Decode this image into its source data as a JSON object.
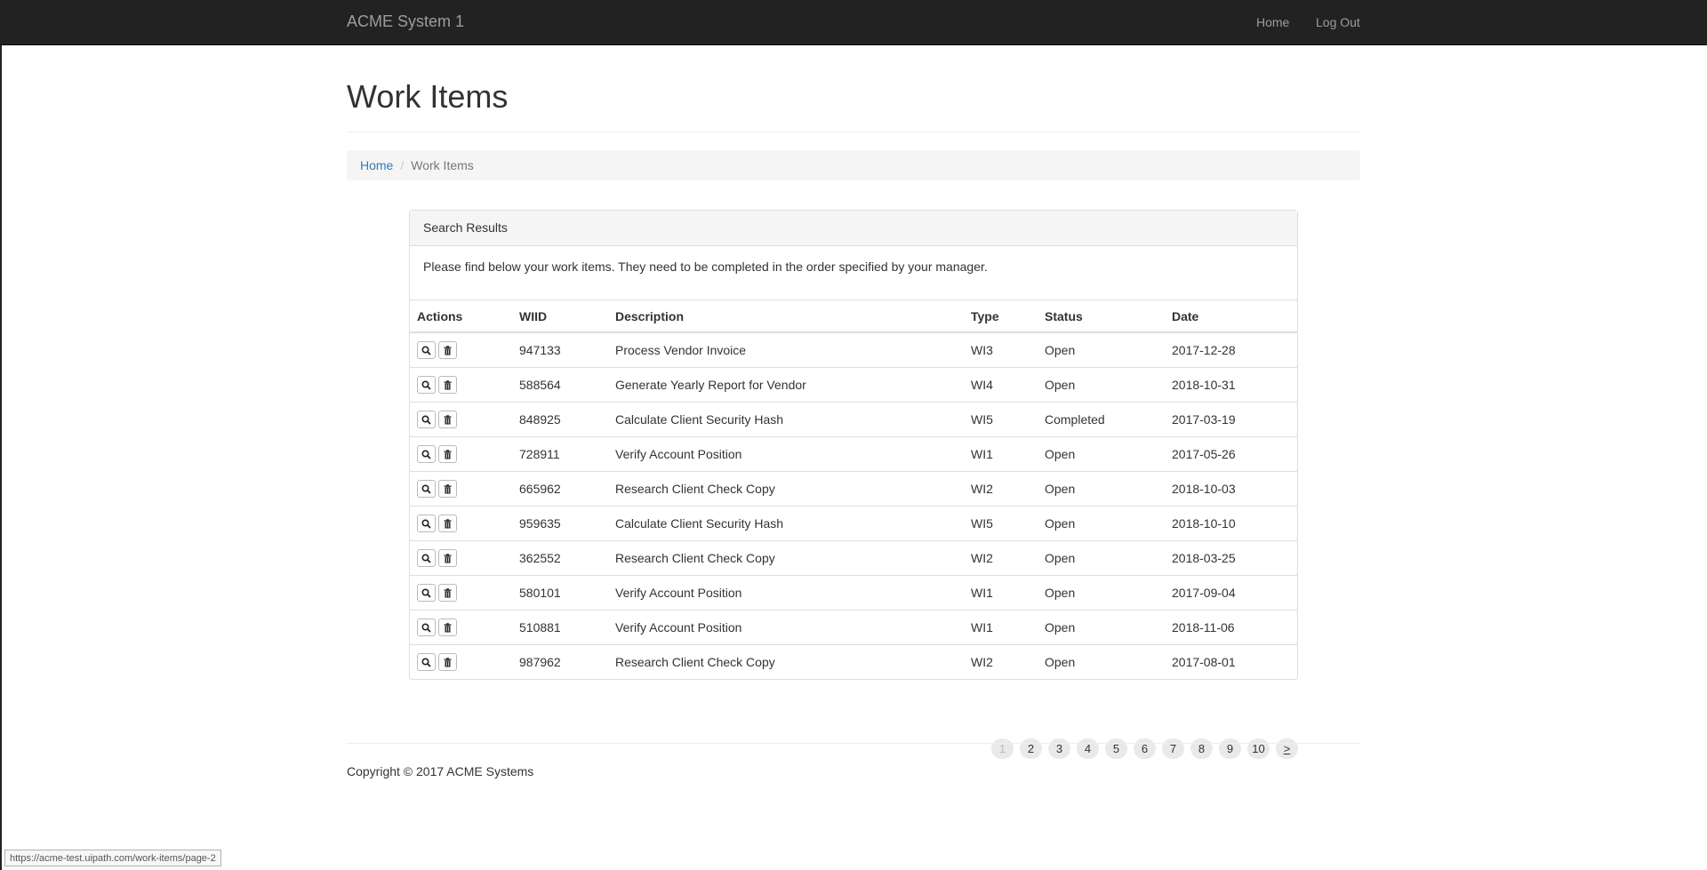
{
  "navbar": {
    "brand": "ACME System 1",
    "links": [
      "Home",
      "Log Out"
    ]
  },
  "page": {
    "title": "Work Items"
  },
  "breadcrumb": {
    "home": "Home",
    "separator": "/",
    "current": "Work Items"
  },
  "panel": {
    "heading": "Search Results",
    "body": "Please find below your work items. They need to be completed in the order specified by your manager."
  },
  "table": {
    "columns": [
      "Actions",
      "WIID",
      "Description",
      "Type",
      "Status",
      "Date"
    ],
    "rows": [
      {
        "wiid": "947133",
        "description": "Process Vendor Invoice",
        "type": "WI3",
        "status": "Open",
        "date": "2017-12-28"
      },
      {
        "wiid": "588564",
        "description": "Generate Yearly Report for Vendor",
        "type": "WI4",
        "status": "Open",
        "date": "2018-10-31"
      },
      {
        "wiid": "848925",
        "description": "Calculate Client Security Hash",
        "type": "WI5",
        "status": "Completed",
        "date": "2017-03-19"
      },
      {
        "wiid": "728911",
        "description": "Verify Account Position",
        "type": "WI1",
        "status": "Open",
        "date": "2017-05-26"
      },
      {
        "wiid": "665962",
        "description": "Research Client Check Copy",
        "type": "WI2",
        "status": "Open",
        "date": "2018-10-03"
      },
      {
        "wiid": "959635",
        "description": "Calculate Client Security Hash",
        "type": "WI5",
        "status": "Open",
        "date": "2018-10-10"
      },
      {
        "wiid": "362552",
        "description": "Research Client Check Copy",
        "type": "WI2",
        "status": "Open",
        "date": "2018-03-25"
      },
      {
        "wiid": "580101",
        "description": "Verify Account Position",
        "type": "WI1",
        "status": "Open",
        "date": "2017-09-04"
      },
      {
        "wiid": "510881",
        "description": "Verify Account Position",
        "type": "WI1",
        "status": "Open",
        "date": "2018-11-06"
      },
      {
        "wiid": "987962",
        "description": "Research Client Check Copy",
        "type": "WI2",
        "status": "Open",
        "date": "2017-08-01"
      }
    ],
    "action_icons": [
      "search-icon",
      "trash-icon"
    ]
  },
  "pagination": {
    "pages": [
      "1",
      "2",
      "3",
      "4",
      "5",
      "6",
      "7",
      "8",
      "9",
      "10"
    ],
    "next": ">",
    "current": "1"
  },
  "footer": {
    "copyright": "Copyright © 2017 ACME Systems"
  },
  "status_bar": {
    "url": "https://acme-test.uipath.com/work-items/page-2"
  }
}
